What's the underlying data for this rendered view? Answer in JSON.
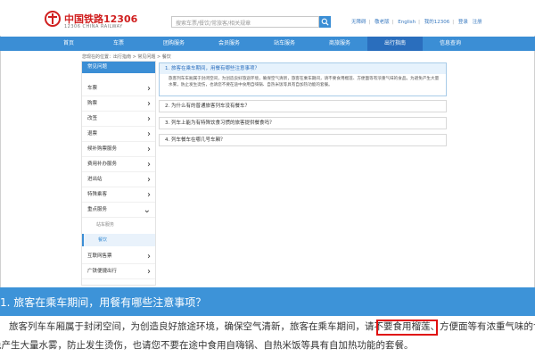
{
  "header": {
    "logo_text": "中国铁路12306",
    "logo_sub": "12306 CHINA RAILWAY",
    "search_placeholder": "搜索车票/餐饮/常旅客/相关规章",
    "links": [
      "无障碍",
      "敬老版",
      "English",
      "我的12306",
      "登录",
      "注册"
    ]
  },
  "nav": {
    "items": [
      "首页",
      "车票",
      "团购服务",
      "会员服务",
      "站车服务",
      "商旅服务",
      "出行指南",
      "信息查询"
    ],
    "active_index": 6
  },
  "breadcrumb": "您现在的位置：出行指南 > 常见问题 > 餐饮",
  "sidebar": {
    "title": "常见问题",
    "items": [
      "车票",
      "购票",
      "改签",
      "退票",
      "候补购票服务",
      "费用补办服务",
      "进出站",
      "特殊乘客",
      "重点服务"
    ],
    "subitems": [
      "站车服务",
      "餐饮"
    ],
    "items_after": [
      "互联网售票",
      "广铁便捷出行"
    ]
  },
  "faq": [
    {
      "question": "1. 旅客在乘车期间，用餐有哪些注意事项？",
      "answer": "旅客列车车厢属于封闭空间，为创造良好旅途环境，确保空气清新，旅客在乘车期间，请不要食用榴莲、方便面等有浓重气味的食品。为避免产生大量水雾，防止发生烫伤，也请您不要在途中食用自嗨锅、自热米饭等具有自加热功能的套餐。"
    },
    {
      "question": "2. 为什么有的普通旅客列车没有餐车？"
    },
    {
      "question": "3. 列车上能为有特殊饮食习惯的旅客提供餐食吗？"
    },
    {
      "question": "4. 列车餐车在哪几号车厢？"
    }
  ],
  "zoom": {
    "title": "1. 旅客在乘车期间，用餐有哪些注意事项？",
    "line1": "旅客列车车厢属于封闭空间，为创造良好旅途环境，确保空气清新，旅客在乘车期间，请不要食用榴莲、方便面等有浓重气味的食品。为避",
    "line2": "免产生大量水雾，防止发生烫伤，也请您不要在途中食用自嗨锅、自热米饭等具有自加热功能的套餐。"
  },
  "colors": {
    "primary": "#3b8ed5",
    "highlight": "#e01010"
  }
}
